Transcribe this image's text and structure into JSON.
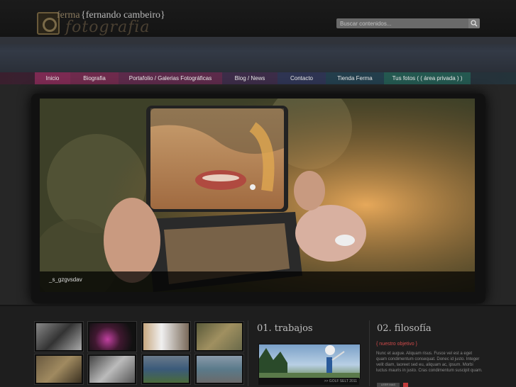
{
  "header": {
    "logo_ferma": "ferma",
    "logo_name": "{fernando cambeiro}",
    "logo_script": "fotografia",
    "search_placeholder": "Buscar contenidos..."
  },
  "nav": {
    "items": [
      {
        "label": "Inicio"
      },
      {
        "label": "Biografia"
      },
      {
        "label": "Portafolio / Galerias Fotográficas"
      },
      {
        "label": "Blog / News"
      },
      {
        "label": "Contacto"
      },
      {
        "label": "Tienda Ferma"
      },
      {
        "label": "Tus fotos ( ( área privada ) )"
      }
    ]
  },
  "slider": {
    "caption": "_s_gzgvsdav"
  },
  "sections": {
    "trabajos_title": "01. trabajos",
    "trabajos_caption": ">> GOLF SELT 2011",
    "filosofia_title": "02. filosofía",
    "objetivo_label": "{ nuestro objetivo }",
    "objetivo_text": "Nunc et augue. Aliquam risus. Fusce vel est a eget quam condimentum consequat. Donec id justo. Integer velit diam, laoreet sed eu, aliquam ac, ipsum. Morbi luctus mauris in justo. Cras condimentum suscipit quam.",
    "leer_label": "LEER MAS"
  },
  "colors": {
    "accent_red": "#c03a3a",
    "nav_inicio": "#7c2a52",
    "nav_tienda": "#245850"
  }
}
